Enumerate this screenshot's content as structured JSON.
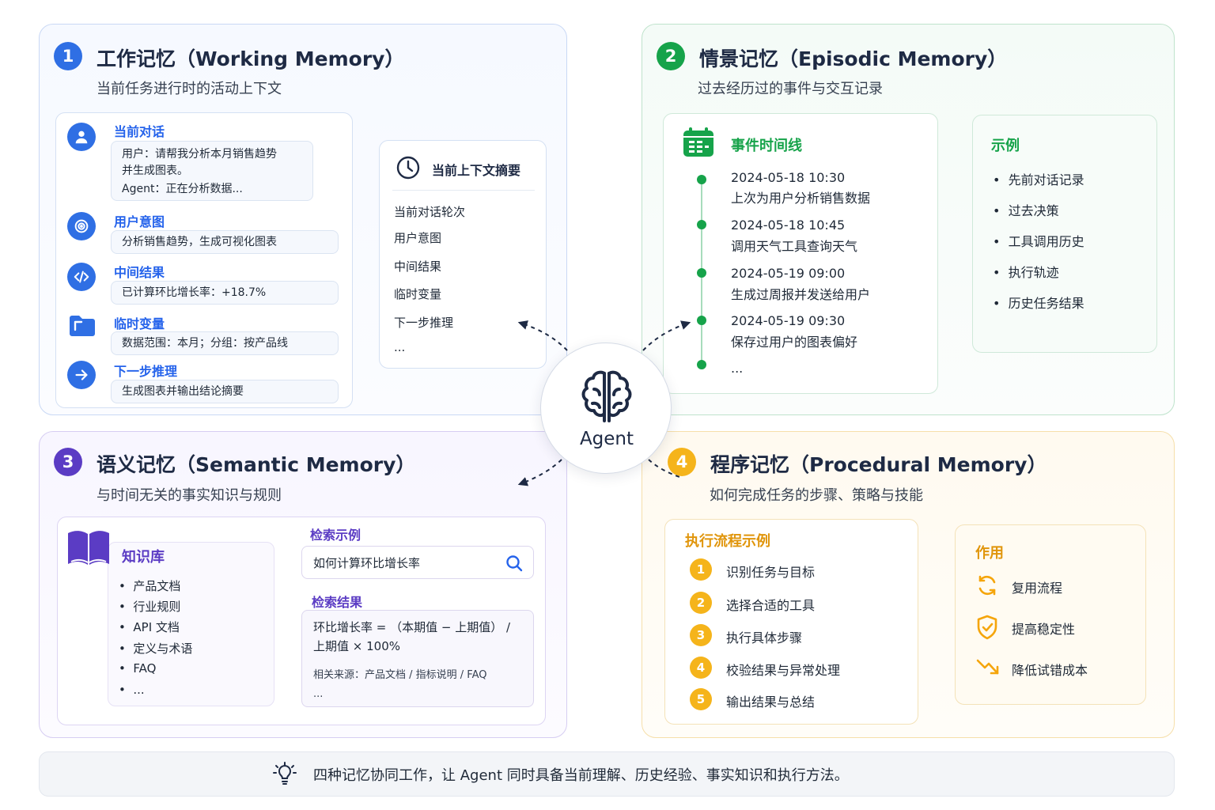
{
  "agent": {
    "label": "Agent"
  },
  "footer": {
    "text": "四种记忆协同工作，让 Agent 同时具备当前理解、历史经验、事实知识和执行方法。"
  },
  "working": {
    "num": "1",
    "title": "工作记忆（Working Memory）",
    "subtitle": "当前任务进行时的活动上下文",
    "items": [
      {
        "label": "当前对话",
        "lines": [
          "用户：请帮我分析本月销售趋势",
          "并生成图表。",
          "Agent：正在分析数据..."
        ]
      },
      {
        "label": "用户意图",
        "lines": [
          "分析销售趋势，生成可视化图表"
        ]
      },
      {
        "label": "中间结果",
        "lines": [
          "已计算环比增长率：+18.7%"
        ]
      },
      {
        "label": "临时变量",
        "lines": [
          "数据范围：本月；分组：按产品线"
        ]
      },
      {
        "label": "下一步推理",
        "lines": [
          "生成图表并输出结论摘要"
        ]
      }
    ],
    "summary": {
      "title": "当前上下文摘要",
      "items": [
        "当前对话轮次",
        "用户意图",
        "中间结果",
        "临时变量",
        "下一步推理",
        "..."
      ]
    }
  },
  "episodic": {
    "num": "2",
    "title": "情景记忆（Episodic Memory）",
    "subtitle": "过去经历过的事件与交互记录",
    "timeline_title": "事件时间线",
    "events": [
      {
        "date": "2024-05-18 10:30",
        "desc": "上次为用户分析销售数据"
      },
      {
        "date": "2024-05-18 10:45",
        "desc": "调用天气工具查询天气"
      },
      {
        "date": "2024-05-19 09:00",
        "desc": "生成过周报并发送给用户"
      },
      {
        "date": "2024-05-19 09:30",
        "desc": "保存过用户的图表偏好"
      }
    ],
    "timeline_more": "...",
    "examples_title": "示例",
    "examples": [
      "先前对话记录",
      "过去决策",
      "工具调用历史",
      "执行轨迹",
      "历史任务结果"
    ]
  },
  "semantic": {
    "num": "3",
    "title": "语义记忆（Semantic Memory）",
    "subtitle": "与时间无关的事实知识与规则",
    "kb_title": "知识库",
    "kb_items": [
      "产品文档",
      "行业规则",
      "API 文档",
      "定义与术语",
      "FAQ",
      "..."
    ],
    "search_title": "检索示例",
    "search_value": "如何计算环比增长率",
    "result_title": "检索结果",
    "result_lines": [
      "环比增长率 = （本期值 − 上期值） /",
      "上期值 × 100%"
    ],
    "result_source": "相关来源：产品文档 / 指标说明 / FAQ",
    "result_more": "..."
  },
  "procedural": {
    "num": "4",
    "title": "程序记忆（Procedural Memory）",
    "subtitle": "如何完成任务的步骤、策略与技能",
    "flow_title": "执行流程示例",
    "steps": [
      {
        "n": "1",
        "text": "识别任务与目标"
      },
      {
        "n": "2",
        "text": "选择合适的工具"
      },
      {
        "n": "3",
        "text": "执行具体步骤"
      },
      {
        "n": "4",
        "text": "校验结果与异常处理"
      },
      {
        "n": "5",
        "text": "输出结果与总结"
      }
    ],
    "use_title": "作用",
    "uses": [
      {
        "icon": "refresh-icon",
        "text": "复用流程"
      },
      {
        "icon": "shield-check-icon",
        "text": "提高稳定性"
      },
      {
        "icon": "trend-down-icon",
        "text": "降低试错成本"
      }
    ]
  },
  "colors": {
    "blue": "#2f6fe4",
    "green": "#16a34a",
    "purple": "#5b3cc4",
    "orange": "#f5b41b"
  }
}
